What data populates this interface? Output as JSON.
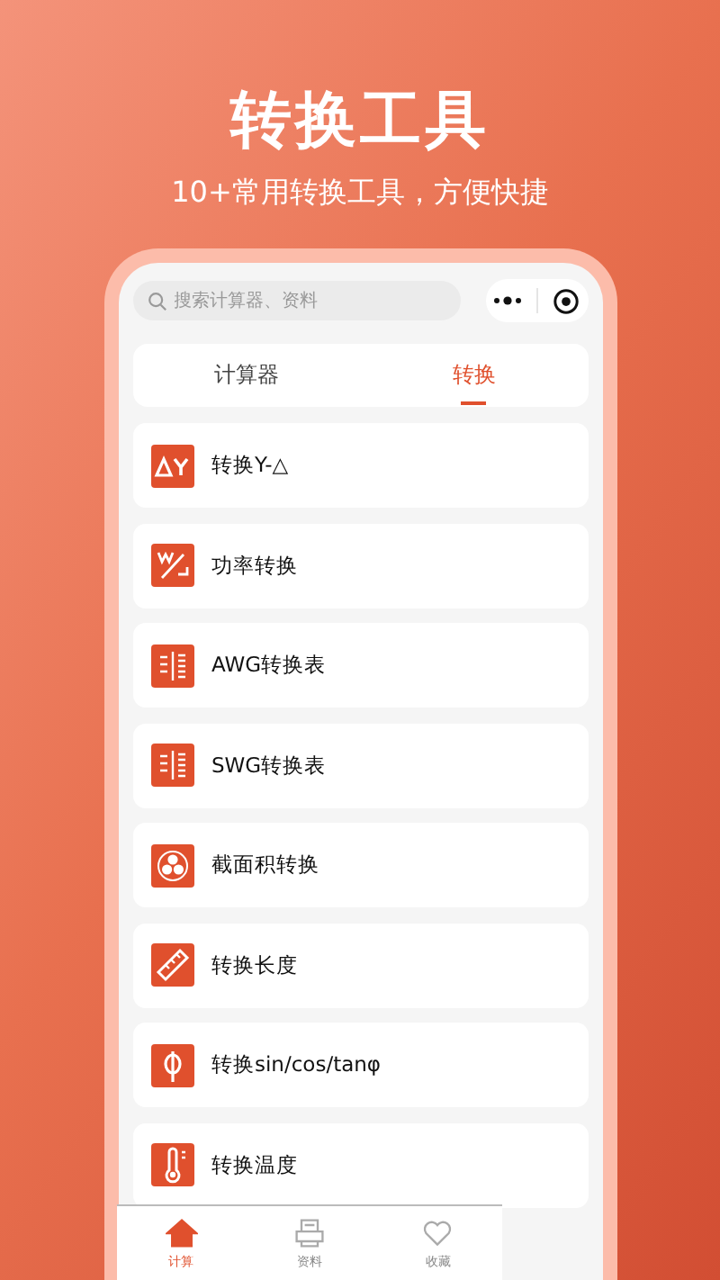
{
  "title": "转换工具",
  "subtitle": "10+常用转换工具，方便快捷",
  "search": {
    "placeholder": "搜索计算器、资料"
  },
  "tabs": [
    {
      "label": "计算器",
      "selected": false
    },
    {
      "label": "转换",
      "selected": true
    }
  ],
  "items": [
    {
      "label": "转换Y-△"
    },
    {
      "label": "功率转换"
    },
    {
      "label": "AWG转换表"
    },
    {
      "label": "SWG转换表"
    },
    {
      "label": "截面积转换"
    },
    {
      "label": "转换长度"
    },
    {
      "label": "转换sin/cos/tanφ"
    },
    {
      "label": "转换温度"
    }
  ],
  "nav": [
    {
      "label": "计算",
      "selected": true
    },
    {
      "label": "资料",
      "selected": false
    },
    {
      "label": "收藏",
      "selected": false
    }
  ]
}
